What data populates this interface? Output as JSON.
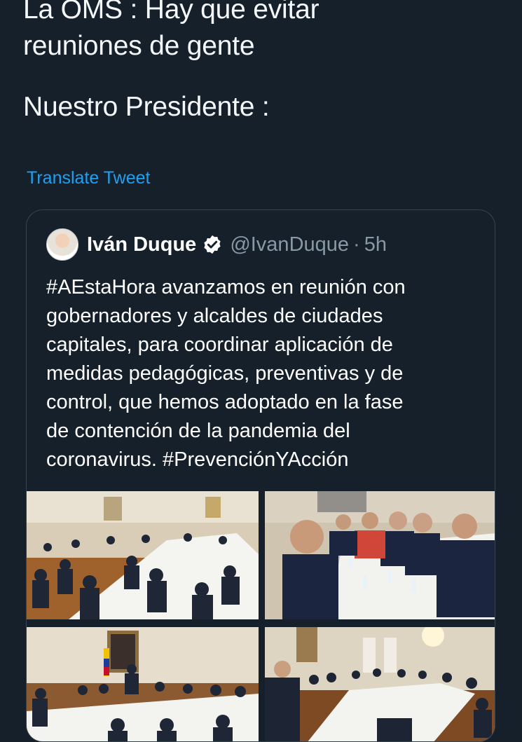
{
  "tweet": {
    "lines": [
      "La OMS : Hay que evitar",
      "reuniones de gente",
      "Nuestro Presidente :"
    ],
    "translate_label": "Translate Tweet"
  },
  "quoted_tweet": {
    "display_name": "Iván Duque",
    "handle": "@IvanDuque",
    "separator": "·",
    "time": "5h",
    "text_lines": [
      "#AEstaHora avanzamos en reunión con",
      "gobernadores y alcaldes de ciudades",
      "capitales, para coordinar aplicación de",
      "medidas pedagógicas, preventivas y de",
      "control, que hemos adoptado en la fase",
      "de contención de la pandemia del",
      "coronavirus. #PrevenciónYAcción"
    ],
    "verified_icon": "verified-badge-icon",
    "photos": [
      "meeting-photo-1",
      "meeting-photo-2",
      "meeting-photo-3",
      "meeting-photo-4"
    ]
  },
  "colors": {
    "background": "#15202b",
    "link": "#1da1f2",
    "muted": "#8899a6",
    "border": "#38444d"
  }
}
